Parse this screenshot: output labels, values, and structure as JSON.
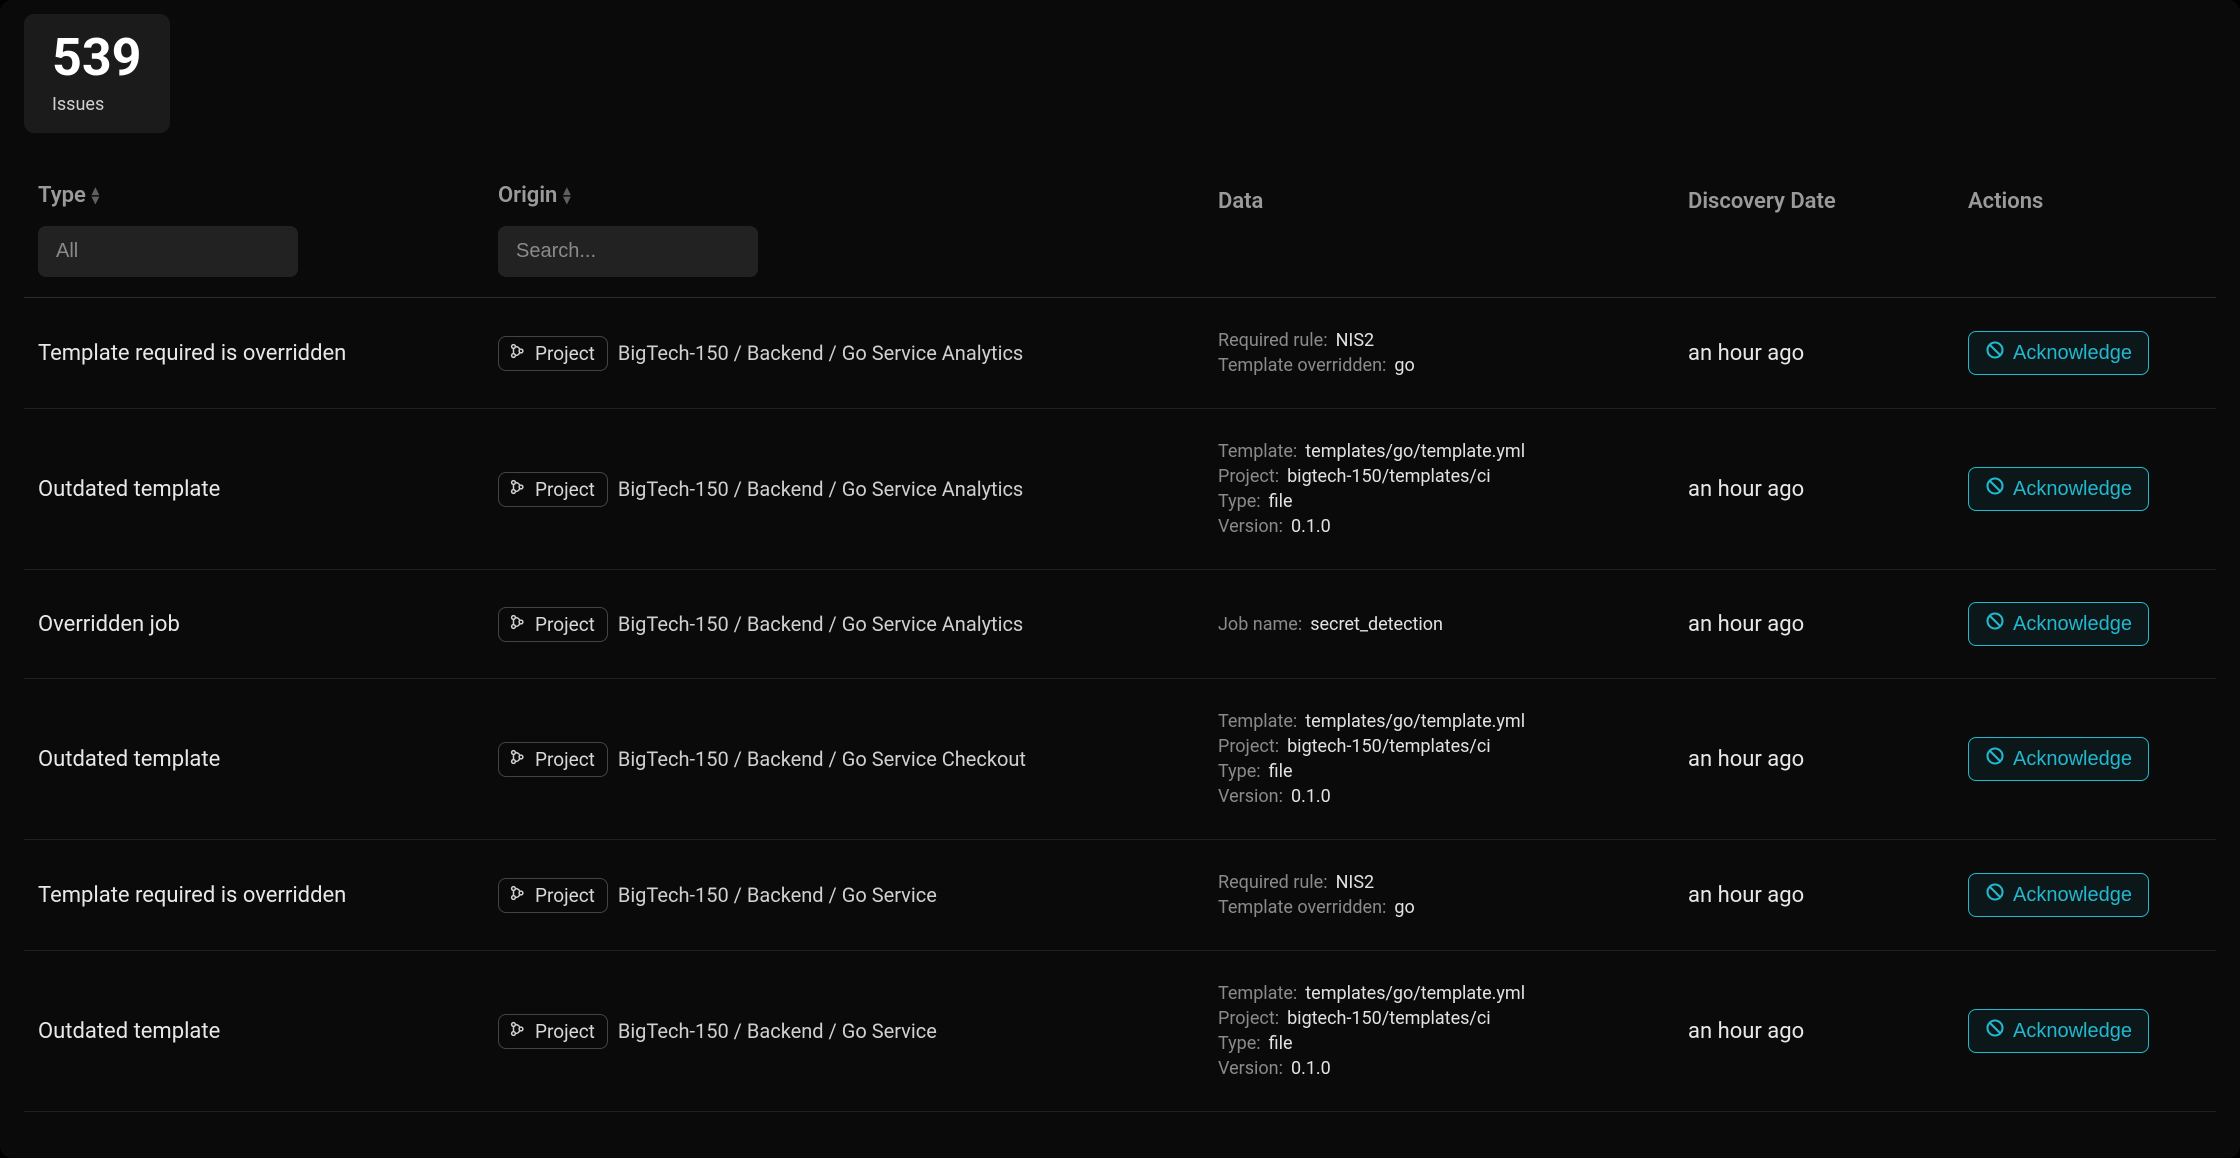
{
  "summary": {
    "count": "539",
    "label": "Issues"
  },
  "columns": {
    "type": "Type",
    "origin": "Origin",
    "data": "Data",
    "discovery": "Discovery Date",
    "actions": "Actions"
  },
  "filters": {
    "type_placeholder": "All",
    "origin_placeholder": "Search..."
  },
  "chip_label": "Project",
  "ack_label": "Acknowledge",
  "rows": [
    {
      "type": "Template required is overridden",
      "origin": "BigTech-150 / Backend / Go Service Analytics",
      "data": [
        {
          "k": "Required rule:",
          "v": "NIS2"
        },
        {
          "k": "Template overridden:",
          "v": "go"
        }
      ],
      "date": "an hour ago"
    },
    {
      "type": "Outdated template",
      "origin": "BigTech-150 / Backend / Go Service Analytics",
      "data": [
        {
          "k": "Template:",
          "v": "templates/go/template.yml"
        },
        {
          "k": "Project:",
          "v": "bigtech-150/templates/ci"
        },
        {
          "k": "Type:",
          "v": "file"
        },
        {
          "k": "Version:",
          "v": "0.1.0"
        }
      ],
      "date": "an hour ago"
    },
    {
      "type": "Overridden job",
      "origin": "BigTech-150 / Backend / Go Service Analytics",
      "data": [
        {
          "k": "Job name:",
          "v": "secret_detection"
        }
      ],
      "date": "an hour ago"
    },
    {
      "type": "Outdated template",
      "origin": "BigTech-150 / Backend / Go Service Checkout",
      "data": [
        {
          "k": "Template:",
          "v": "templates/go/template.yml"
        },
        {
          "k": "Project:",
          "v": "bigtech-150/templates/ci"
        },
        {
          "k": "Type:",
          "v": "file"
        },
        {
          "k": "Version:",
          "v": "0.1.0"
        }
      ],
      "date": "an hour ago"
    },
    {
      "type": "Template required is overridden",
      "origin": "BigTech-150 / Backend / Go Service",
      "data": [
        {
          "k": "Required rule:",
          "v": "NIS2"
        },
        {
          "k": "Template overridden:",
          "v": "go"
        }
      ],
      "date": "an hour ago"
    },
    {
      "type": "Outdated template",
      "origin": "BigTech-150 / Backend / Go Service",
      "data": [
        {
          "k": "Template:",
          "v": "templates/go/template.yml"
        },
        {
          "k": "Project:",
          "v": "bigtech-150/templates/ci"
        },
        {
          "k": "Type:",
          "v": "file"
        },
        {
          "k": "Version:",
          "v": "0.1.0"
        }
      ],
      "date": "an hour ago"
    }
  ]
}
